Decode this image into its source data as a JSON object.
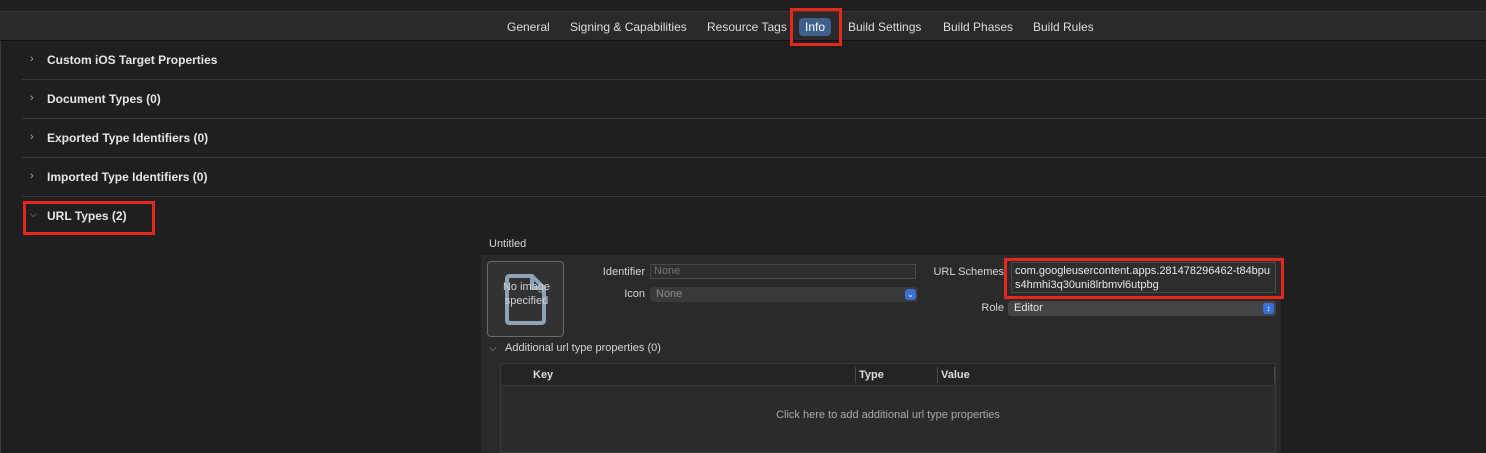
{
  "tabs": [
    {
      "label": "General"
    },
    {
      "label": "Signing & Capabilities"
    },
    {
      "label": "Resource Tags"
    },
    {
      "label": "Info"
    },
    {
      "label": "Build Settings"
    },
    {
      "label": "Build Phases"
    },
    {
      "label": "Build Rules"
    }
  ],
  "active_tab": "Info",
  "sections": [
    {
      "label": "Custom iOS Target Properties",
      "expanded": false
    },
    {
      "label": "Document Types (0)",
      "expanded": false
    },
    {
      "label": "Exported Type Identifiers (0)",
      "expanded": false
    },
    {
      "label": "Imported Type Identifiers (0)",
      "expanded": false
    },
    {
      "label": "URL Types (2)",
      "expanded": true
    }
  ],
  "url_type": {
    "title": "Untitled",
    "image_placeholder": "No image specified",
    "identifier_label": "Identifier",
    "identifier_placeholder": "None",
    "icon_label": "Icon",
    "icon_value": "None",
    "schemes_label": "URL Schemes",
    "schemes_value": "com.googleusercontent.apps.281478296462-t84bpus4hmhi3q30uni8lrbmvl6utpbg",
    "role_label": "Role",
    "role_value": "Editor",
    "additional_label": "Additional url type properties (0)",
    "columns": [
      "Key",
      "Type",
      "Value"
    ],
    "add_hint": "Click here to add additional url type properties"
  },
  "colors": {
    "background": "#1f1e20",
    "tab_active": "#3f5f8c",
    "highlight": "#e8271b",
    "popup_accent": "#3a6fd8"
  },
  "icons": {
    "section_collapsed": "chevron-right-icon",
    "section_expanded": "chevron-down-icon",
    "popup": "chevron-updown-icon",
    "image_placeholder": "document-icon"
  }
}
